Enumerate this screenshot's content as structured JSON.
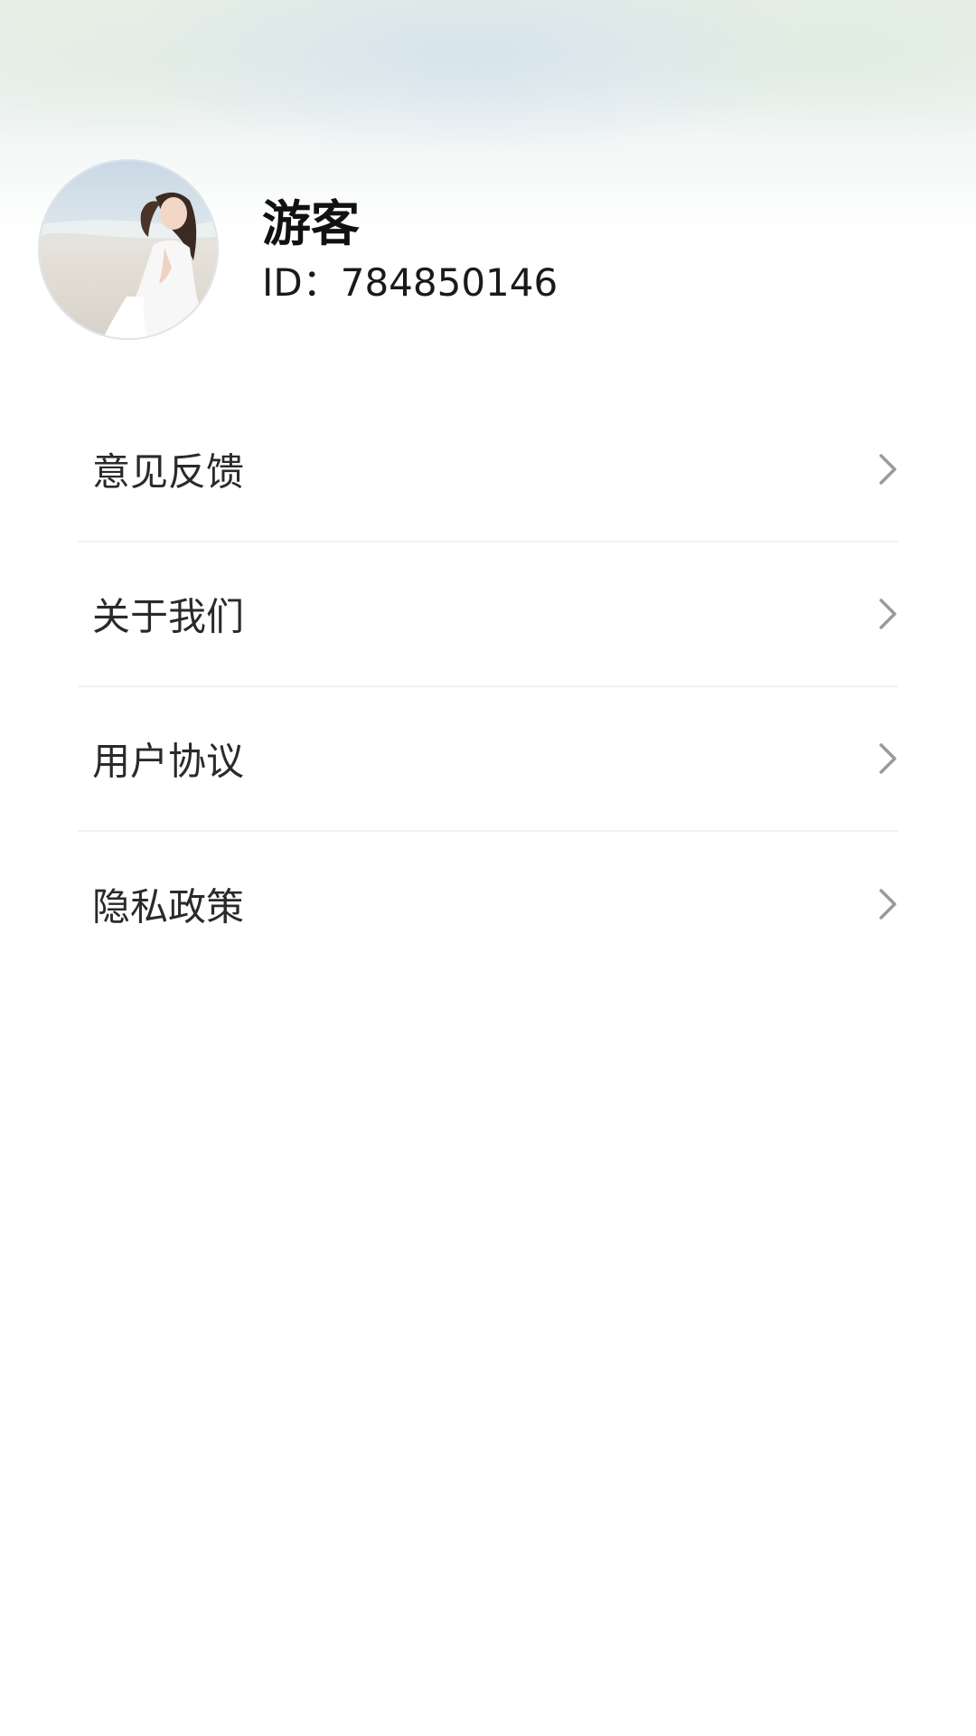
{
  "profile": {
    "name": "游客",
    "id_text": "ID：784850146",
    "avatar_icon": "avatar-photo"
  },
  "menu": {
    "items": [
      {
        "label": "意见反馈",
        "icon": "chevron-right-icon"
      },
      {
        "label": "关于我们",
        "icon": "chevron-right-icon"
      },
      {
        "label": "用户协议",
        "icon": "chevron-right-icon"
      },
      {
        "label": "隐私政策",
        "icon": "chevron-right-icon"
      }
    ]
  },
  "colors": {
    "background": "#ffffff",
    "text_primary": "#111111",
    "text_menu": "#2a2a2a",
    "chevron": "#9a9a9a",
    "divider": "#f1f1f1"
  }
}
